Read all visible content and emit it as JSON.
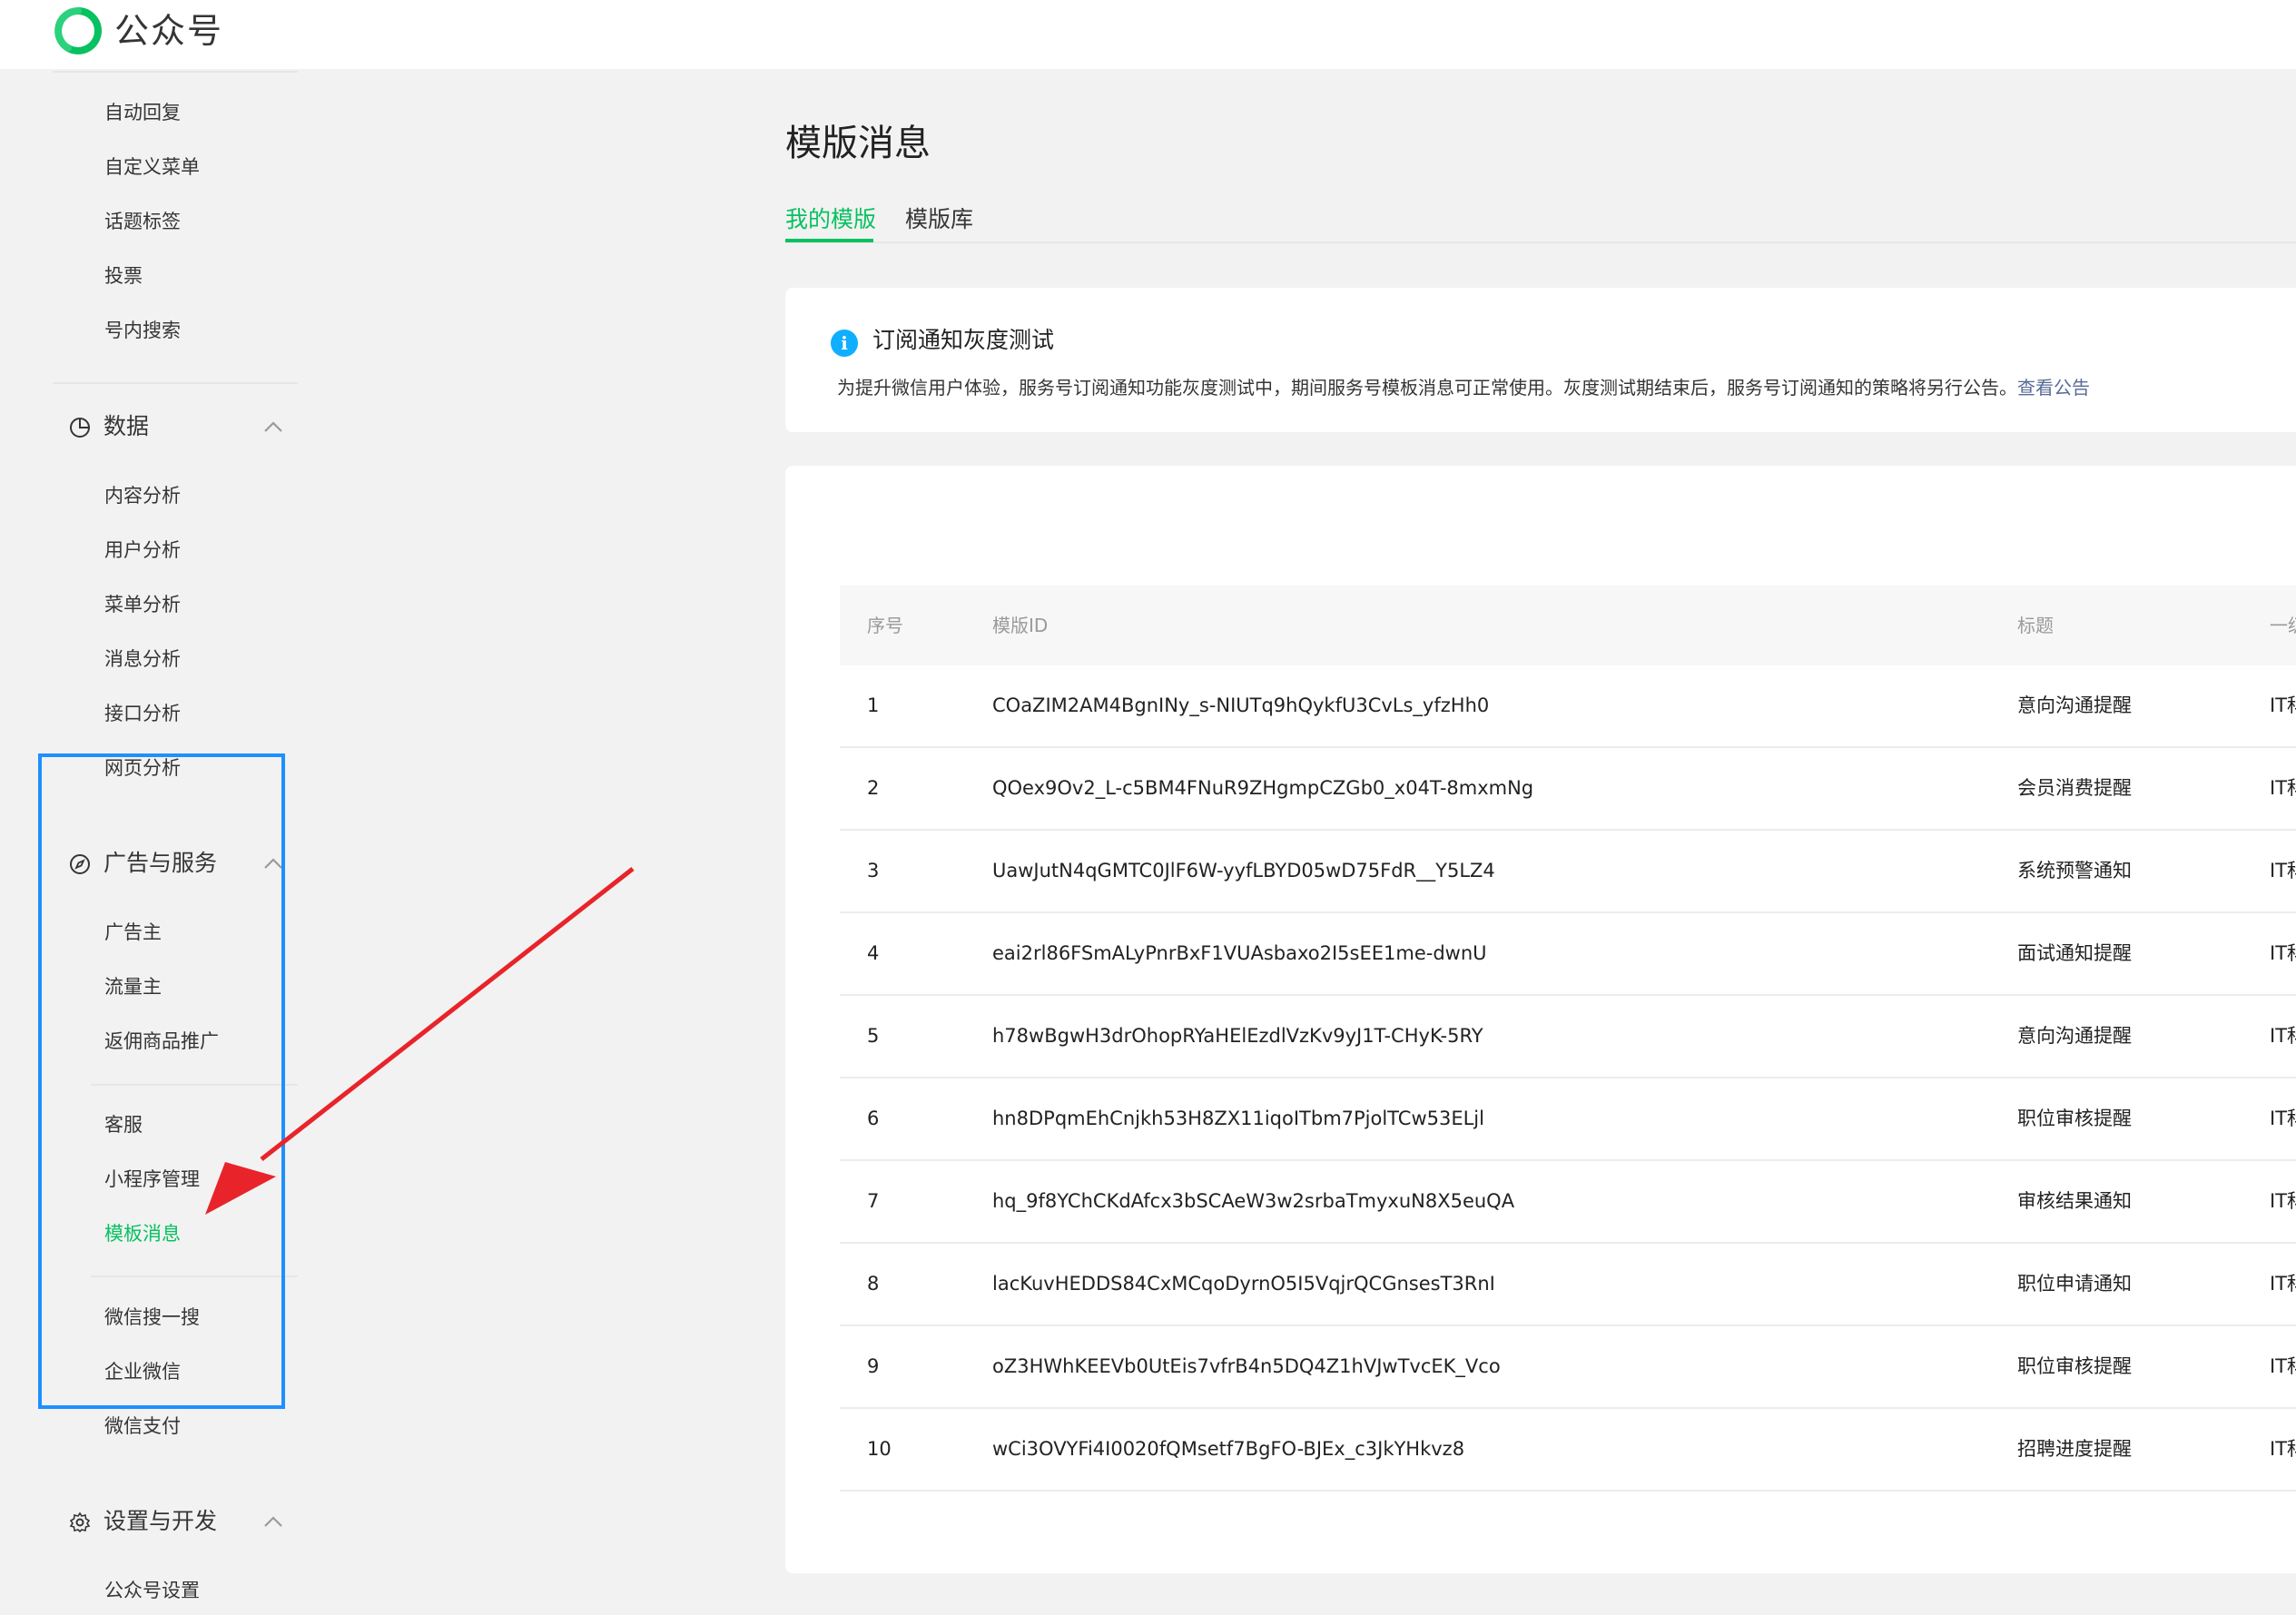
{
  "header": {
    "brand": "公众号",
    "logo_icon": "wechat-official-account-logo",
    "brand_color": "#07c160"
  },
  "sidebar": {
    "pre_items": [
      "自动回复",
      "自定义菜单",
      "话题标签",
      "投票",
      "号内搜索"
    ],
    "groups": [
      {
        "label": "数据",
        "icon": "pie-chart-icon",
        "items": [
          "内容分析",
          "用户分析",
          "菜单分析",
          "消息分析",
          "接口分析",
          "网页分析"
        ]
      },
      {
        "label": "广告与服务",
        "icon": "compass-icon",
        "items": [
          "广告主",
          "流量主",
          "返佣商品推广",
          "客服",
          "小程序管理",
          "模板消息",
          "微信搜一搜",
          "企业微信",
          "微信支付"
        ],
        "active_item": "模板消息"
      },
      {
        "label": "设置与开发",
        "icon": "gear-icon",
        "items": [
          "公众号设置"
        ]
      }
    ]
  },
  "main": {
    "title": "模版消息",
    "tabs": [
      {
        "label": "我的模版",
        "active": true
      },
      {
        "label": "模版库",
        "active": false
      }
    ],
    "notice": {
      "icon": "info-icon",
      "title": "订阅通知灰度测试",
      "desc": "为提升微信用户体验，服务号订阅通知功能灰度测试中，期间服务号模板消息可正常使用。灰度测试期结束后，服务号订阅通知的策略将另行公告。",
      "link": "查看公告"
    },
    "table": {
      "headers": [
        "序号",
        "模版ID",
        "标题",
        "一级行业"
      ],
      "rows": [
        {
          "no": "1",
          "id": "COaZIM2AM4BgnINy_s-NIUTq9hQykfU3CvLs_yfzHh0",
          "title": "意向沟通提醒",
          "industry": "IT科技"
        },
        {
          "no": "2",
          "id": "QOex9Ov2_L-c5BM4FNuR9ZHgmpCZGb0_x04T-8mxmNg",
          "title": "会员消费提醒",
          "industry": "IT科技"
        },
        {
          "no": "3",
          "id": "UawJutN4qGMTC0JlF6W-yyfLBYD05wD75FdR__Y5LZ4",
          "title": "系统预警通知",
          "industry": "IT科技"
        },
        {
          "no": "4",
          "id": "eai2rl86FSmALyPnrBxF1VUAsbaxo2I5sEE1me-dwnU",
          "title": "面试通知提醒",
          "industry": "IT科技"
        },
        {
          "no": "5",
          "id": "h78wBgwH3drOhopRYaHElEzdlVzKv9yJ1T-CHyK-5RY",
          "title": "意向沟通提醒",
          "industry": "IT科技"
        },
        {
          "no": "6",
          "id": "hn8DPqmEhCnjkh53H8ZX11iqoITbm7PjolTCw53ELjl",
          "title": "职位审核提醒",
          "industry": "IT科技"
        },
        {
          "no": "7",
          "id": "hq_9f8YChCKdAfcx3bSCAeW3w2srbaTmyxuN8X5euQA",
          "title": "审核结果通知",
          "industry": "IT科技"
        },
        {
          "no": "8",
          "id": "lacKuvHEDDS84CxMCqoDyrnO5I5VqjrQCGnsesT3RnI",
          "title": "职位申请通知",
          "industry": "IT科技"
        },
        {
          "no": "9",
          "id": "oZ3HWhKEEVb0UtEis7vfrB4n5DQ4Z1hVJwTvcEK_Vco",
          "title": "职位审核提醒",
          "industry": "IT科技"
        },
        {
          "no": "10",
          "id": "wCi3OVYFi4I0020fQMsetf7BgFO-BJEx_c3JkYHkvz8",
          "title": "招聘进度提醒",
          "industry": "IT科技"
        }
      ]
    }
  },
  "annotation": {
    "highlight_color": "#1e90ff",
    "arrow_color": "#e8242a"
  }
}
